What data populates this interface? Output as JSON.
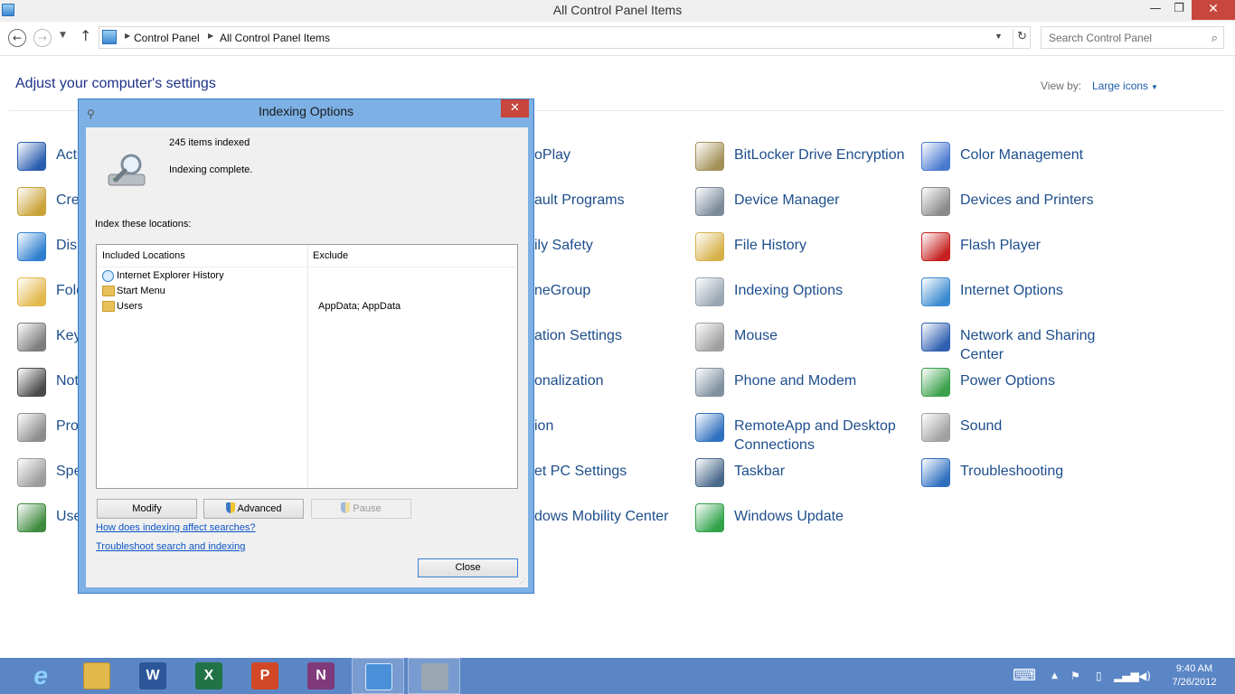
{
  "window": {
    "title": "All Control Panel Items",
    "minimize": "—",
    "maximize": "❐",
    "close": "✕"
  },
  "nav": {
    "breadcrumbs": [
      "Control Panel",
      "All Control Panel Items"
    ],
    "search_placeholder": "Search Control Panel"
  },
  "header": {
    "title": "Adjust your computer's settings",
    "view_by_label": "View by:",
    "view_by_value": "Large icons"
  },
  "items": [
    {
      "label": "Acti",
      "icon": "flag-icon",
      "color": "#2a5db0"
    },
    {
      "label": "Cre",
      "icon": "credential-vault-icon",
      "color": "#c9a337"
    },
    {
      "label": "Disp",
      "icon": "display-icon",
      "color": "#2f7fd0"
    },
    {
      "label": "Fold",
      "icon": "folder-options-icon",
      "color": "#e2b84c"
    },
    {
      "label": "Key",
      "icon": "keyboard-icon",
      "color": "#7d7d7d"
    },
    {
      "label": "Not",
      "icon": "notification-icon",
      "color": "#4a4a4a"
    },
    {
      "label": "Pro",
      "icon": "programs-icon",
      "color": "#8d8d8d"
    },
    {
      "label": "Spe",
      "icon": "microphone-icon",
      "color": "#9c9c9c"
    },
    {
      "label": "Use",
      "icon": "user-accounts-icon",
      "color": "#3f8a3f"
    },
    {
      "label": "oPlay",
      "icon": "autoplay-icon",
      "color": "#4caf50"
    },
    {
      "label": "ault Programs",
      "icon": "default-programs-icon",
      "color": "#4caf50"
    },
    {
      "label": "ily Safety",
      "icon": "family-safety-icon",
      "color": "#4caf50"
    },
    {
      "label": "neGroup",
      "icon": "homegroup-icon",
      "color": "#4caf50"
    },
    {
      "label": "ation Settings",
      "icon": "location-icon",
      "color": "#4caf50"
    },
    {
      "label": "onalization",
      "icon": "personalization-icon",
      "color": "#4caf50"
    },
    {
      "label": "ion",
      "icon": "recovery-icon",
      "color": "#4caf50"
    },
    {
      "label": "et PC Settings",
      "icon": "tablet-settings-icon",
      "color": "#4caf50"
    },
    {
      "label": "dows Mobility Center",
      "icon": "mobility-center-icon",
      "color": "#4caf50"
    },
    {
      "label": "BitLocker Drive Encryption",
      "icon": "bitlocker-icon",
      "color": "#a39058"
    },
    {
      "label": "Device Manager",
      "icon": "device-manager-icon",
      "color": "#7a8a99"
    },
    {
      "label": "File History",
      "icon": "file-history-icon",
      "color": "#d6b14a"
    },
    {
      "label": "Indexing Options",
      "icon": "indexing-icon",
      "color": "#9aa7b3"
    },
    {
      "label": "Mouse",
      "icon": "mouse-icon",
      "color": "#a0a0a0"
    },
    {
      "label": "Phone and Modem",
      "icon": "phone-icon",
      "color": "#8090a0"
    },
    {
      "label": "RemoteApp and Desktop Connections",
      "icon": "remoteapp-icon",
      "color": "#2f6fc0"
    },
    {
      "label": "Taskbar",
      "icon": "taskbar-icon",
      "color": "#4a6a8a"
    },
    {
      "label": "Windows Update",
      "icon": "windows-update-icon",
      "color": "#2fa24a"
    },
    {
      "label": "Color Management",
      "icon": "color-management-icon",
      "color": "#4a7ad0"
    },
    {
      "label": "Devices and Printers",
      "icon": "printer-icon",
      "color": "#8a8a8a"
    },
    {
      "label": "Flash Player",
      "icon": "flash-icon",
      "color": "#c62020"
    },
    {
      "label": "Internet Options",
      "icon": "internet-options-icon",
      "color": "#3a8ad0"
    },
    {
      "label": "Network and Sharing Center",
      "icon": "network-icon",
      "color": "#2f5fb0"
    },
    {
      "label": "Power Options",
      "icon": "power-icon",
      "color": "#3aa04a"
    },
    {
      "label": "Sound",
      "icon": "speaker-icon",
      "color": "#a0a0a0"
    },
    {
      "label": "Troubleshooting",
      "icon": "troubleshooting-icon",
      "color": "#2f6fc0"
    }
  ],
  "dialog": {
    "title": "Indexing Options",
    "items_indexed": "245 items indexed",
    "status": "Indexing complete.",
    "index_label": "Index these locations:",
    "columns": [
      "Included Locations",
      "Exclude"
    ],
    "locations": [
      {
        "name": "Internet Explorer History",
        "exclude": ""
      },
      {
        "name": "Start Menu",
        "exclude": ""
      },
      {
        "name": "Users",
        "exclude": "AppData; AppData"
      }
    ],
    "modify": "Modify",
    "advanced": "Advanced",
    "pause": "Pause",
    "link_affect": "How does indexing affect searches?",
    "link_troubleshoot": "Troubleshoot search and indexing",
    "close": "Close"
  },
  "taskbar": {
    "apps": [
      {
        "name": "internet-explorer",
        "glyph": "e",
        "color": "#2f8fd8"
      },
      {
        "name": "file-explorer",
        "glyph": "",
        "color": "#e2b84c"
      },
      {
        "name": "word",
        "glyph": "W",
        "color": "#2b579a"
      },
      {
        "name": "excel",
        "glyph": "X",
        "color": "#217346"
      },
      {
        "name": "powerpoint",
        "glyph": "P",
        "color": "#d24726"
      },
      {
        "name": "onenote",
        "glyph": "N",
        "color": "#80397b"
      },
      {
        "name": "control-panel",
        "glyph": "",
        "color": "#4a90d9"
      },
      {
        "name": "indexing-options",
        "glyph": "",
        "color": "#9aa7b3"
      }
    ],
    "time": "9:40 AM",
    "date": "7/26/2012"
  }
}
